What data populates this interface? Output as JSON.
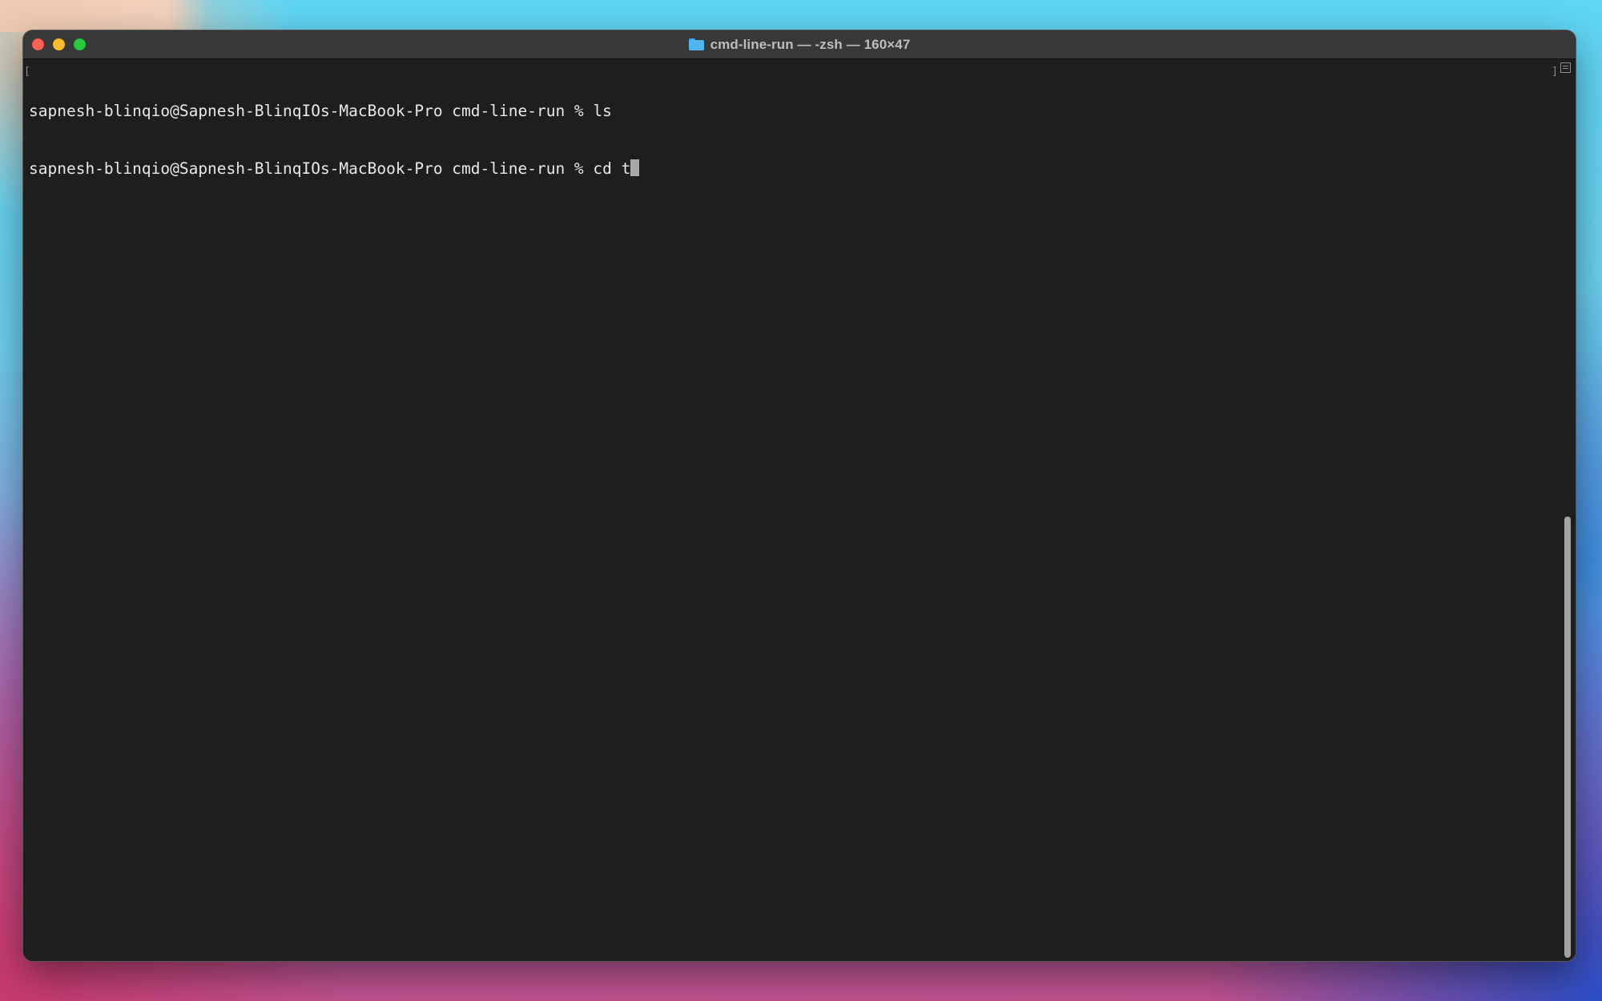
{
  "window": {
    "title": "cmd-line-run — -zsh — 160×47",
    "title_icon": "folder-icon"
  },
  "terminal": {
    "lines": [
      "sapnesh-blinqio@Sapnesh-BlinqIOs-MacBook-Pro cmd-line-run % ls",
      "sapnesh-blinqio@Sapnesh-BlinqIOs-MacBook-Pro cmd-line-run % cd t"
    ],
    "mark_left": "[",
    "mark_right": "]"
  },
  "scrollbar": {
    "thumb_start_fraction": 0.5,
    "thumb_end_fraction": 1.0
  },
  "colors": {
    "close": "#fe5f57",
    "minimize": "#febc2e",
    "zoom": "#28c840",
    "terminal_bg": "#1e1e1e",
    "terminal_fg": "#e8e8e8"
  }
}
